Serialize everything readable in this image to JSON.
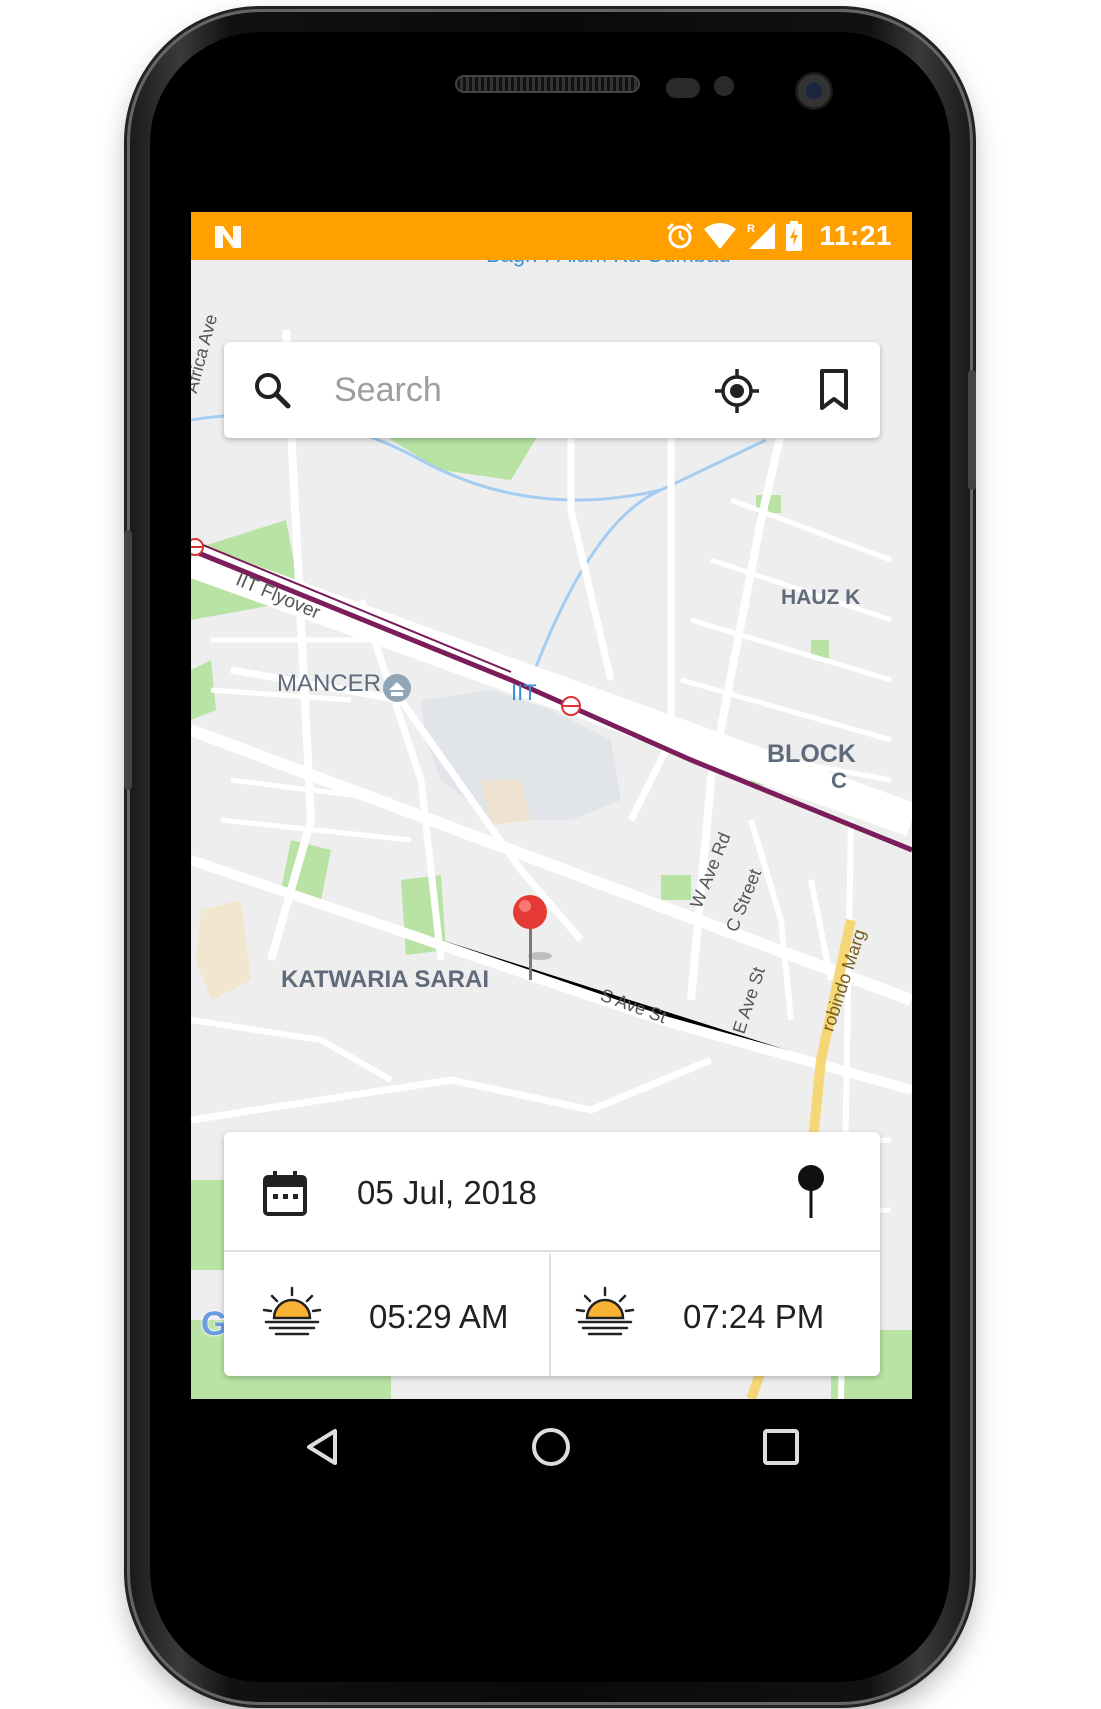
{
  "status_bar": {
    "time": "11:21",
    "app_icon": "n-notification-icon",
    "icons": [
      "alarm-icon",
      "wifi-icon",
      "signal-roaming-icon",
      "battery-charging-icon"
    ],
    "background_color": "#FFA000"
  },
  "search": {
    "placeholder": "Search",
    "value": "",
    "locate_icon": "my-location-icon",
    "bookmark_icon": "bookmark-icon"
  },
  "map": {
    "labels": {
      "top_partial": "Bagh-i-Alam Ka Gumbad",
      "africa_ave": "Africa Ave",
      "iit_flyover": "IIT Flyover",
      "hauz_k": "HAUZ K",
      "mancer": "MANCER",
      "iit": "IIT",
      "block": "BLOCK",
      "block_c": "C",
      "w_ave_rd": "W Ave Rd",
      "c_street": "C Street",
      "katwaria_sarai": "KATWARIA SARAI",
      "s_ave_st": "S Ave St",
      "e_ave_st": "E Ave St",
      "aurobindo_marg": "robindo Marg"
    },
    "attribution": "Google",
    "metro_line_color": "#7b1d5a",
    "park_color": "#b9e3a5",
    "water_color": "#a5cdf2"
  },
  "info": {
    "date": "05 Jul, 2018",
    "sunrise": "05:29 AM",
    "sunset": "07:24 PM",
    "accent_color": "#F9B233"
  },
  "nav": {
    "back": "back-icon",
    "home": "home-icon",
    "recents": "recents-icon"
  }
}
